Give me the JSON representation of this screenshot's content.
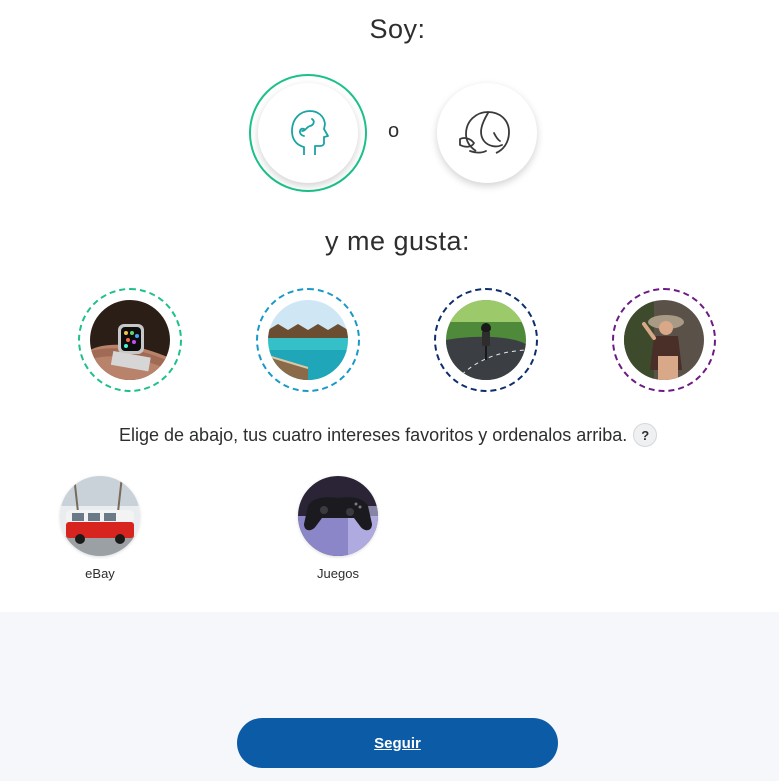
{
  "heading_soy": "Soy:",
  "gender": {
    "or_text": "o",
    "male_icon": "male-head-icon",
    "female_icon": "female-head-icon",
    "selected": "male",
    "accent": "#1cc08a"
  },
  "heading_gusta": "y me gusta:",
  "slots": [
    {
      "image": "smartwatch-photo",
      "ring_color": "#1cc08a"
    },
    {
      "image": "beach-resort-photo",
      "ring_color": "#1899c8"
    },
    {
      "image": "cyclist-photo",
      "ring_color": "#0e2d6d"
    },
    {
      "image": "woman-hat-photo",
      "ring_color": "#6c1a84"
    }
  ],
  "instructions": "Elige de abajo, tus cuatro intereses favoritos y ordenalos arriba.",
  "help_label": "?",
  "options": [
    {
      "label": "eBay",
      "image": "red-van-photo"
    },
    {
      "label": "Juegos",
      "image": "game-controller-photo"
    }
  ],
  "button": {
    "label": "Seguir",
    "color": "#0b5ba6"
  }
}
